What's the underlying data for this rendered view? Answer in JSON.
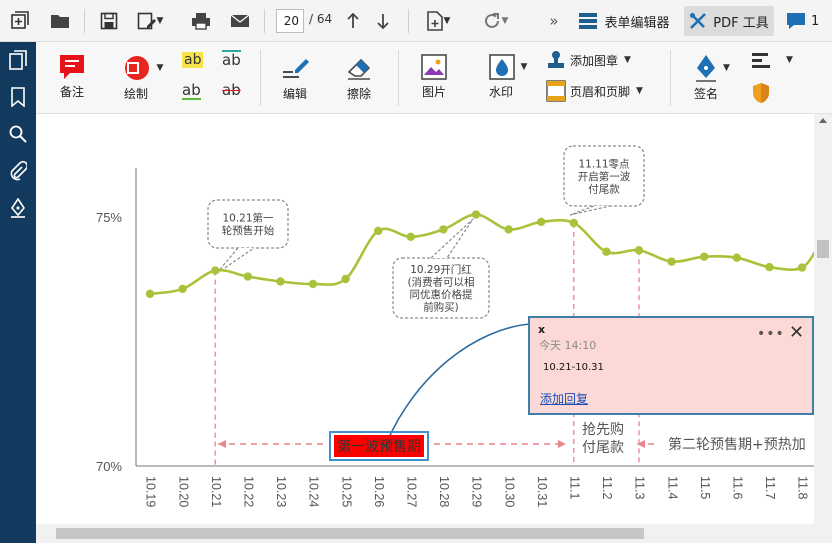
{
  "toolbar": {
    "page_current": "20",
    "page_total": "/ 64",
    "more": "»",
    "form_editor": "表单编辑器",
    "pdf_tools": "PDF 工具",
    "comments_count": "1"
  },
  "ribbon": {
    "note": "备注",
    "draw": "绘制",
    "edit": "编辑",
    "erase": "擦除",
    "image": "图片",
    "watermark": "水印",
    "add_stamp": "添加图章",
    "header_footer": "页眉和页脚",
    "sign": "签名",
    "ab": "ab"
  },
  "colors": {
    "sidebar": "#113a5e",
    "line": "#a8c33a",
    "marker_line": "#e8868a",
    "selected_box": "#ff0000",
    "popup_bg": "#fcd9d7",
    "popup_border": "#3f7fa7"
  },
  "chart_data": {
    "type": "line",
    "x": [
      "10.19",
      "10.20",
      "10.21",
      "10.22",
      "10.23",
      "10.24",
      "10.25",
      "10.26",
      "10.27",
      "10.28",
      "10.29",
      "10.30",
      "10.31",
      "11.1",
      "11.2",
      "11.3",
      "11.4",
      "11.5",
      "11.6",
      "11.7",
      "11.8"
    ],
    "series": [
      {
        "values": [
          73.45,
          73.55,
          73.92,
          73.8,
          73.7,
          73.65,
          73.75,
          74.72,
          74.6,
          74.75,
          75.05,
          74.75,
          74.9,
          74.88,
          74.3,
          74.33,
          74.1,
          74.2,
          74.18,
          73.99,
          73.98
        ]
      }
    ],
    "extra_point": {
      "x": "11.8+",
      "y": 74.5
    },
    "yticks": [
      "75%",
      "70%"
    ],
    "callouts": [
      {
        "label": "10.21第一轮预售开始",
        "lines": [
          "10.21第一",
          "轮预售开始"
        ]
      },
      {
        "label": "10.29开门红(消费者可以相同优惠价格提前购买)",
        "lines": [
          "10.29开门红",
          "(消费者可以相",
          "同优惠价格提",
          "前购买)"
        ]
      },
      {
        "label": "11.11零点开启第一波付尾款",
        "lines": [
          "11.11零点",
          "开启第一波",
          "付尾款"
        ]
      }
    ],
    "phases": {
      "first": "第一波预售期",
      "buy_line1": "抢先购",
      "buy_line2": "付尾款",
      "second": "第二轮预售期+预热加"
    }
  },
  "popup": {
    "close_x": "x",
    "time": "今天 14:10",
    "text": "10.21-10.31",
    "reply": "添加回复",
    "more": "•••",
    "close": "✕"
  }
}
